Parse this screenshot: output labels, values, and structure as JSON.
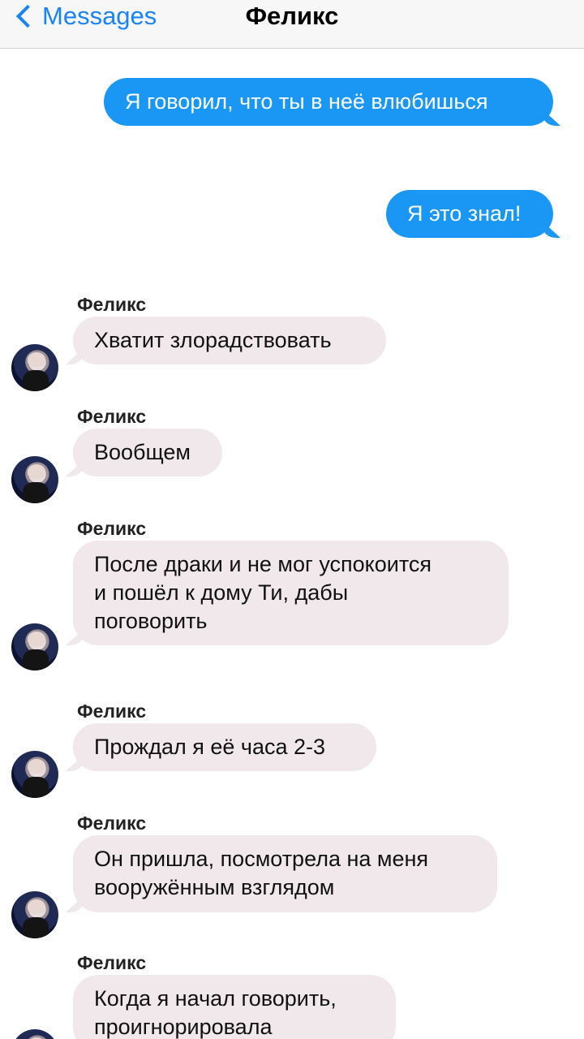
{
  "nav": {
    "back_label": "Messages",
    "title": "Феликс"
  },
  "icons": {
    "back": "chevron-left-icon",
    "avatar": "avatar-icon"
  },
  "colors": {
    "accent": "#1a82fb",
    "outgoing_bubble": "#1a96f5",
    "incoming_bubble": "#f0e8ea"
  },
  "messages": [
    {
      "direction": "outgoing",
      "text": "Я говорил, что ты в неё влюбишься"
    },
    {
      "direction": "outgoing",
      "text": "Я это знал!"
    },
    {
      "direction": "incoming",
      "sender": "Феликс",
      "text": "Хватит злорадствовать"
    },
    {
      "direction": "incoming",
      "sender": "Феликс",
      "text": "Вообщем"
    },
    {
      "direction": "incoming",
      "sender": "Феликс",
      "lines": [
        "После драки и не мог успокоится",
        "и пошёл к дому Ти, дабы",
        "поговорить"
      ]
    },
    {
      "direction": "incoming",
      "sender": "Феликс",
      "text": "Прождал я её часа 2-3"
    },
    {
      "direction": "incoming",
      "sender": "Феликс",
      "lines": [
        "Он пришла, посмотрела на меня",
        "вооружённым взглядом"
      ]
    },
    {
      "direction": "incoming",
      "sender": "Феликс",
      "lines": [
        "Когда я начал говорить,",
        "проигнорировала"
      ]
    }
  ]
}
